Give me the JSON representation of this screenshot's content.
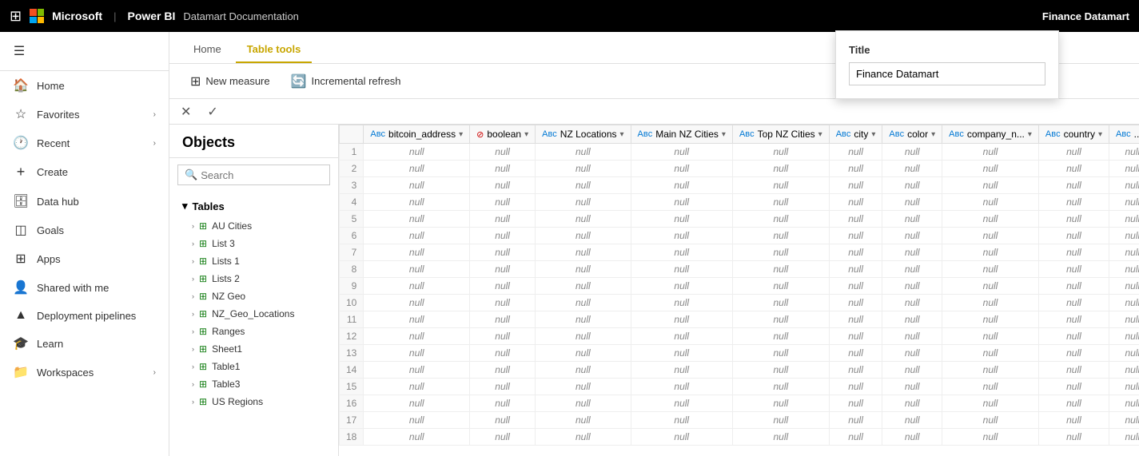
{
  "topNav": {
    "appGridLabel": "⊞",
    "companyName": "Microsoft",
    "appName": "Power BI",
    "breadcrumb": "Datamart Documentation",
    "titlePopup": {
      "label": "Title",
      "value": "Finance Datamart"
    },
    "rightTitle": "Finance Datamart"
  },
  "sidebar": {
    "hamburgerIcon": "☰",
    "items": [
      {
        "id": "home",
        "icon": "🏠",
        "label": "Home",
        "hasChevron": false
      },
      {
        "id": "favorites",
        "icon": "☆",
        "label": "Favorites",
        "hasChevron": true
      },
      {
        "id": "recent",
        "icon": "🕐",
        "label": "Recent",
        "hasChevron": true
      },
      {
        "id": "create",
        "icon": "+",
        "label": "Create",
        "hasChevron": false
      },
      {
        "id": "datahub",
        "icon": "🗄",
        "label": "Data hub",
        "hasChevron": false
      },
      {
        "id": "goals",
        "icon": "📊",
        "label": "Goals",
        "hasChevron": false
      },
      {
        "id": "apps",
        "icon": "⊞",
        "label": "Apps",
        "hasChevron": false
      },
      {
        "id": "sharedwithme",
        "icon": "👤",
        "label": "Shared with me",
        "hasChevron": false
      },
      {
        "id": "deployment",
        "icon": "🚀",
        "label": "Deployment pipelines",
        "hasChevron": false
      },
      {
        "id": "learn",
        "icon": "🎓",
        "label": "Learn",
        "hasChevron": false
      },
      {
        "id": "workspaces",
        "icon": "📁",
        "label": "Workspaces",
        "hasChevron": true
      }
    ]
  },
  "tabs": [
    {
      "id": "home",
      "label": "Home",
      "active": false
    },
    {
      "id": "tabletools",
      "label": "Table tools",
      "active": true
    }
  ],
  "toolbar": {
    "newMeasureIcon": "📊",
    "newMeasureLabel": "New measure",
    "incrementalRefreshIcon": "🔄",
    "incrementalRefreshLabel": "Incremental refresh"
  },
  "formulaBar": {
    "closeIcon": "✕",
    "confirmIcon": "✓"
  },
  "objects": {
    "header": "Objects",
    "searchPlaceholder": "Search",
    "tablesHeader": "Tables",
    "tables": [
      "AU Cities",
      "List 3",
      "Lists 1",
      "Lists 2",
      "NZ Geo",
      "NZ_Geo_Locations",
      "Ranges",
      "Sheet1",
      "Table1",
      "Table3",
      "US Regions"
    ]
  },
  "tableColumns": [
    {
      "type": "abc",
      "typeCss": "text",
      "name": "bitcoin_address"
    },
    {
      "type": "bool",
      "typeCss": "bool",
      "name": "boolean"
    },
    {
      "type": "abc",
      "typeCss": "text",
      "name": "NZ Locations"
    },
    {
      "type": "abc",
      "typeCss": "text",
      "name": "Main NZ Cities"
    },
    {
      "type": "abc",
      "typeCss": "text",
      "name": "Top NZ Cities"
    },
    {
      "type": "abc",
      "typeCss": "text",
      "name": "city"
    },
    {
      "type": "abc",
      "typeCss": "text",
      "name": "color"
    },
    {
      "type": "abc",
      "typeCss": "text",
      "name": "company_n..."
    },
    {
      "type": "abc",
      "typeCss": "text",
      "name": "country"
    },
    {
      "type": "abc",
      "typeCss": "text",
      "name": "..."
    }
  ],
  "tableRows": 18,
  "nullValue": "null"
}
